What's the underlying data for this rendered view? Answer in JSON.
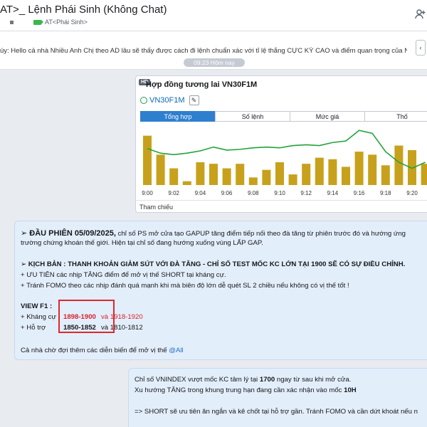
{
  "header": {
    "title": "AT>_ Lệnh Phái Sinh (Không Chat)",
    "subtitle": "AT<Phái Sinh>"
  },
  "pinned": {
    "text": "úy: Hello cả nhà Nhiều Anh Chị theo AD lâu sẽ thấy được cách đi lệnh chuẩn xác với tỉ lệ thắng CỰC KỲ CAO và điểm quan trọng của NĐT là cần phải ..."
  },
  "time_divider": "09:23 Hôm nay",
  "card": {
    "badge": "HD",
    "title": "Hợp đồng tương lai VN30F1M",
    "symbol": "VN30F1M",
    "tabs": [
      "Tổng hợp",
      "Số lệnh",
      "Mức giá",
      "Thố"
    ],
    "active_tab": 0,
    "footer": "Tham chiếu",
    "chart_data": {
      "type": "bar",
      "categories": [
        "9:00",
        "",
        "9:02",
        "",
        "9:04",
        "",
        "9:06",
        "",
        "9:08",
        "",
        "9:10",
        "",
        "9:12",
        "",
        "9:14",
        "",
        "9:16",
        "",
        "9:18",
        "",
        "9:20",
        ""
      ],
      "x_tick_labels": [
        "9:00",
        "9:02",
        "9:04",
        "9:06",
        "9:08",
        "9:10",
        "9:12",
        "9:14",
        "9:16",
        "9:18",
        "9:20"
      ],
      "series": [
        {
          "values": [
            65,
            40,
            22,
            5,
            30,
            28,
            22,
            28,
            10,
            20,
            30,
            14,
            28,
            36,
            34,
            24,
            44,
            40,
            26,
            52,
            46,
            28
          ]
        },
        {
          "values": [
            48,
            42,
            40,
            42,
            45,
            50,
            46,
            47,
            49,
            50,
            49,
            52,
            53,
            52,
            56,
            58,
            72,
            68,
            44,
            30,
            22,
            30
          ]
        }
      ],
      "colors": [
        "#c8a11c",
        "#22a33a"
      ],
      "ylim": [
        0,
        75
      ]
    }
  },
  "msg1": {
    "line1_prefix": "➢ ĐẦU PHIÊN 05/09/2025,",
    "line1_rest": " chỉ số PS mở cửa tạo GAPUP tăng điểm tiếp nối theo đà tăng từ phiên trước đó và hướng ứng",
    "line2": "trường chứng khoán thế giới. Hiện tại chỉ số đang hướng xuống vùng LẤP GAP.",
    "line3": "➢ KỊCH BẢN : THANH KHOẢN GIẢM SÚT VỚI ĐÀ TĂNG - CHỈ SỐ TEST MỐC KC LỚN TẠI 1900 SẼ CÓ SỰ ĐIỀU CHỈNH.",
    "line4": "+ ƯU TIÊN các nhịp TĂNG điểm để mở vị thế SHORT tại kháng cự.",
    "line5": "+ Tránh FOMO theo các nhịp đánh quá mạnh khi mà biên độ lớn dễ quét SL 2 chiều nếu không có vị thế tốt !",
    "line6": "VIEW F1 :",
    "resist_label": "+ Kháng cự",
    "resist_1": "1898-1900",
    "resist_and": " và ",
    "resist_2": "1918-1920",
    "support_label": "+ Hỗ trợ",
    "support_1": "1850-1852",
    "support_rest": " và 1810-1812",
    "line9_prefix": "Cả nhà chờ đợi thêm các diễn biến để mở vị thế ",
    "mention": "@All"
  },
  "msg2": {
    "l1_a": "Chỉ số VNINDEX vượt mốc KC tâm lý tại ",
    "l1_b": "1700",
    "l1_c": " ngay từ sau khi mở cửa.",
    "l2_a": "Xu hướng TĂNG trong khung trung hạn đang cần xác nhận vào mốc ",
    "l2_b": "10H",
    "l3": "=> SHORT sẽ ưu tiên ăn ngắn và kê chốt tại hỗ trợ gần. Tránh FOMO và cần dứt khoát nếu n"
  }
}
